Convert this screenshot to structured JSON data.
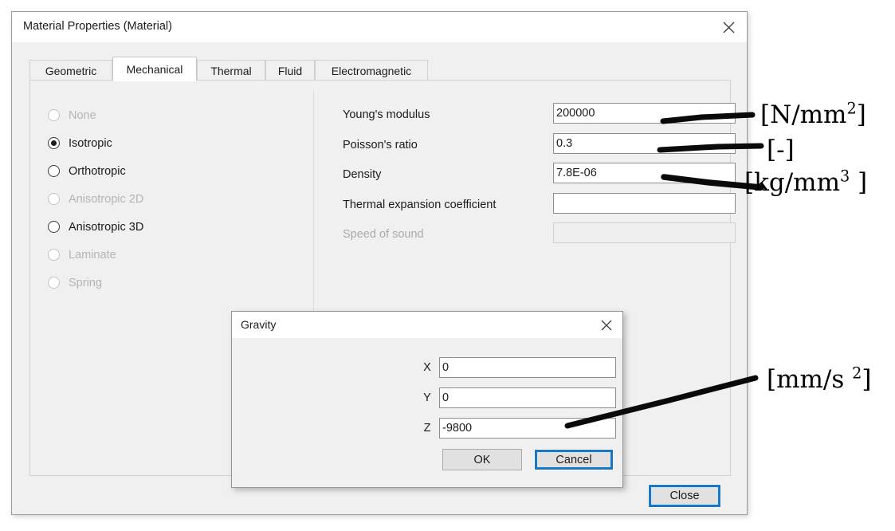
{
  "window": {
    "title": "Material Properties (Material)",
    "close_icon": "close-icon",
    "close_button_label": "Close"
  },
  "tabs": [
    {
      "label": "Geometric",
      "active": false
    },
    {
      "label": "Mechanical",
      "active": true
    },
    {
      "label": "Thermal",
      "active": false
    },
    {
      "label": "Fluid",
      "active": false
    },
    {
      "label": "Electromagnetic",
      "active": false
    }
  ],
  "material_models": [
    {
      "label": "None",
      "checked": false,
      "disabled": true
    },
    {
      "label": "Isotropic",
      "checked": true,
      "disabled": false
    },
    {
      "label": "Orthotropic",
      "checked": false,
      "disabled": false
    },
    {
      "label": "Anisotropic 2D",
      "checked": false,
      "disabled": true
    },
    {
      "label": "Anisotropic 3D",
      "checked": false,
      "disabled": false
    },
    {
      "label": "Laminate",
      "checked": false,
      "disabled": true
    },
    {
      "label": "Spring",
      "checked": false,
      "disabled": true
    }
  ],
  "properties": [
    {
      "label": "Young's modulus",
      "value": "200000",
      "disabled": false
    },
    {
      "label": "Poisson's ratio",
      "value": "0.3",
      "disabled": false
    },
    {
      "label": "Density",
      "value": "7.8E-06",
      "disabled": false
    },
    {
      "label": "Thermal expansion coefficient",
      "value": "",
      "disabled": false
    },
    {
      "label": "Speed of sound",
      "value": "",
      "disabled": true
    }
  ],
  "gravity_dialog": {
    "title": "Gravity",
    "close_icon": "close-icon",
    "fields": [
      {
        "label": "X",
        "value": "0"
      },
      {
        "label": "Y",
        "value": "0"
      },
      {
        "label": "Z",
        "value": "-9800"
      }
    ],
    "ok_label": "OK",
    "cancel_label": "Cancel"
  },
  "annotations": [
    {
      "id": "youngs-modulus-unit",
      "text_main": "[N/mm",
      "sup": "2",
      "text_tail": "]"
    },
    {
      "id": "poissons-ratio-unit",
      "text_main": "[-]",
      "sup": "",
      "text_tail": ""
    },
    {
      "id": "density-unit",
      "text_main": "[kg/mm",
      "sup": "3",
      "text_tail": " ]"
    },
    {
      "id": "gravity-unit",
      "text_main": "[mm/s ",
      "sup": "2",
      "text_tail": "]"
    }
  ],
  "colors": {
    "window_bg": "#f0f0f0",
    "titlebar_bg": "#ffffff",
    "focus_blue": "#1878c8",
    "annotation_ink": "#000000",
    "disabled_text": "#b4b4b4"
  }
}
